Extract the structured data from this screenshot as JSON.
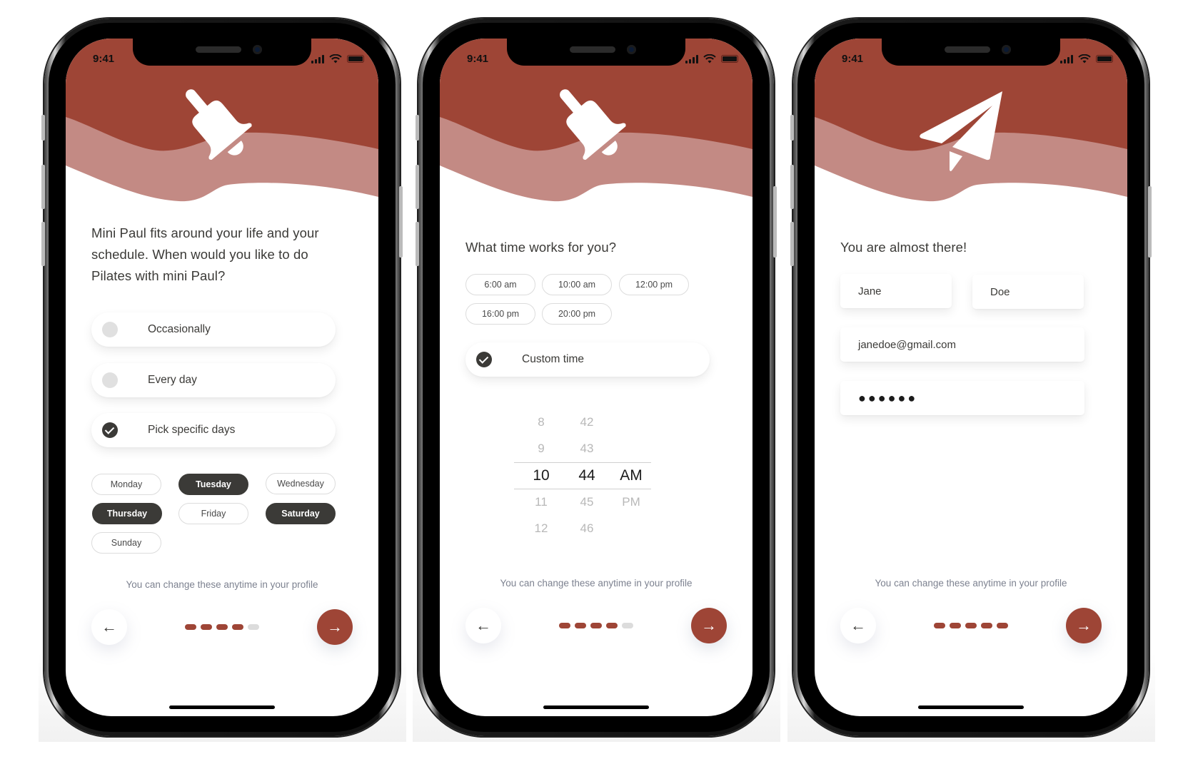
{
  "colors": {
    "brand_dark": "#9e4536",
    "brand_light": "#c38a84",
    "chip_selected": "#3b3a37",
    "dot_inactive": "#dcdcdc"
  },
  "screens": [
    {
      "status_time": "9:41",
      "hero_icon": "bell-icon",
      "question": "Mini Paul fits around your life and your schedule. When would you like to do Pilates with mini Paul?",
      "options": [
        {
          "label": "Occasionally",
          "checked": false
        },
        {
          "label": "Every day",
          "checked": false
        },
        {
          "label": "Pick specific days",
          "checked": true
        }
      ],
      "days": [
        {
          "label": "Monday",
          "selected": false
        },
        {
          "label": "Tuesday",
          "selected": true
        },
        {
          "label": "Wednesday",
          "selected": false
        },
        {
          "label": "Thursday",
          "selected": true
        },
        {
          "label": "Friday",
          "selected": false
        },
        {
          "label": "Saturday",
          "selected": true
        },
        {
          "label": "Sunday",
          "selected": false
        }
      ],
      "footnote": "You can change these anytime in your profile",
      "progress": {
        "active_steps": 4,
        "total_steps": 5
      },
      "back_icon": "arrow-left-icon",
      "next_icon": "arrow-right-icon"
    },
    {
      "status_time": "9:41",
      "hero_icon": "bell-icon",
      "question": "What time works for you?",
      "time_options": [
        "6:00 am",
        "10:00 am",
        "12:00 pm",
        "16:00 pm",
        "20:00 pm"
      ],
      "custom_option": {
        "label": "Custom time",
        "checked": true
      },
      "picker": {
        "rows": [
          [
            "8",
            "42",
            ""
          ],
          [
            "9",
            "43",
            ""
          ],
          [
            "10",
            "44",
            "AM"
          ],
          [
            "11",
            "45",
            "PM"
          ],
          [
            "12",
            "46",
            ""
          ]
        ],
        "selected": {
          "hour": "10",
          "minute": "44",
          "period": "AM"
        }
      },
      "footnote": "You can change these anytime in your profile",
      "progress": {
        "active_steps": 4,
        "total_steps": 5
      },
      "back_icon": "arrow-left-icon",
      "next_icon": "arrow-right-icon"
    },
    {
      "status_time": "9:41",
      "hero_icon": "paper-plane-icon",
      "question": "You are almost there!",
      "fields": {
        "first_name": "Jane",
        "last_name": "Doe",
        "email": "janedoe@gmail.com",
        "password_mask": "●●●●●●"
      },
      "footnote": "You can change these anytime in your profile",
      "progress": {
        "active_steps": 5,
        "total_steps": 5
      },
      "back_icon": "arrow-left-icon",
      "next_icon": "arrow-right-icon"
    }
  ],
  "glyphs": {
    "arrow_left": "←",
    "arrow_right": "→"
  }
}
